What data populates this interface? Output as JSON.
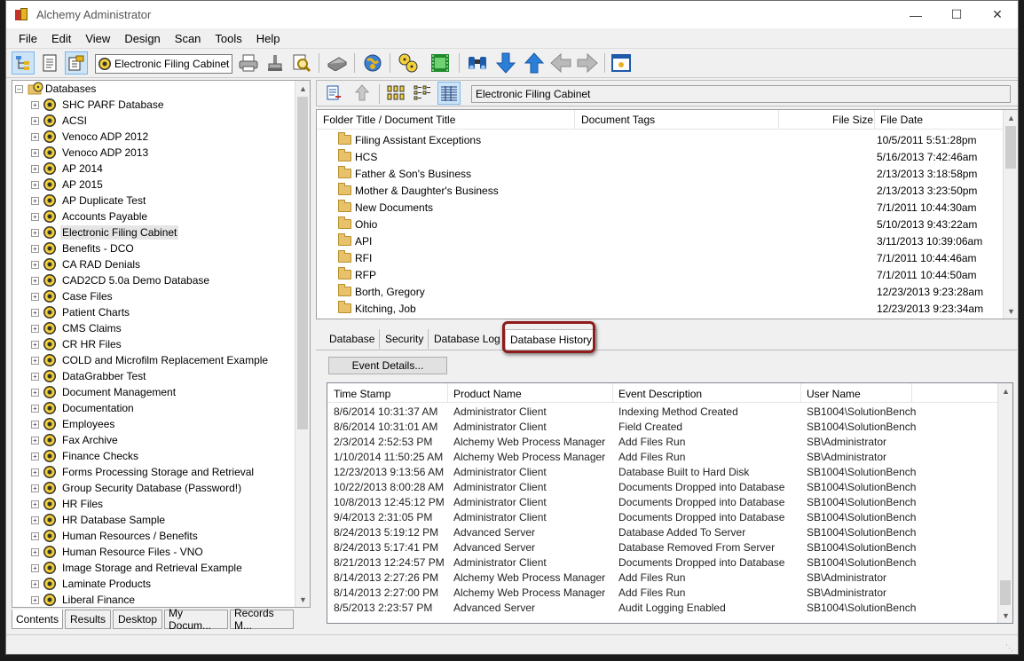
{
  "window": {
    "title": "Alchemy Administrator",
    "controls": {
      "minimize": "—",
      "maximize": "☐",
      "close": "✕"
    }
  },
  "menu": [
    "File",
    "Edit",
    "View",
    "Design",
    "Scan",
    "Tools",
    "Help"
  ],
  "toolbar": {
    "database_combo_value": "Electronic Filing Cabinet"
  },
  "tree": {
    "root_label": "Databases",
    "items": [
      "SHC PARF Database",
      "ACSI",
      "Venoco ADP 2012",
      "Venoco ADP 2013",
      "AP 2014",
      "AP 2015",
      "AP Duplicate Test",
      "Accounts Payable",
      "Electronic Filing Cabinet",
      "Benefits - DCO",
      "CA RAD Denials",
      "CAD2CD 5.0a Demo Database",
      "Case Files",
      "Patient Charts",
      "CMS Claims",
      "CR HR Files",
      "COLD and Microfilm Replacement Example",
      "DataGrabber Test",
      "Document Management",
      "Documentation",
      "Employees",
      "Fax Archive",
      "Finance Checks",
      "Forms Processing Storage and Retrieval",
      "Group Security Database (Password!)",
      "HR Files",
      "HR Database Sample",
      "Human Resources / Benefits",
      "Human Resource Files - VNO",
      "Image Storage and Retrieval Example",
      "Laminate Products",
      "Liberal Finance"
    ],
    "selected": "Electronic Filing Cabinet"
  },
  "left_tabs": [
    "Contents",
    "Results",
    "Desktop",
    "My Docum...",
    "Records M..."
  ],
  "right_toolbar": {
    "path": "Electronic Filing Cabinet"
  },
  "file_list": {
    "columns": [
      "Folder Title / Document Title",
      "Document Tags",
      "File Size",
      "File Date"
    ],
    "rows": [
      {
        "title": "Filing Assistant Exceptions",
        "date": "10/5/2011 5:51:28pm"
      },
      {
        "title": "HCS",
        "date": "5/16/2013 7:42:46am"
      },
      {
        "title": "Father & Son's Business",
        "date": "2/13/2013 3:18:58pm"
      },
      {
        "title": "Mother & Daughter's Business",
        "date": "2/13/2013 3:23:50pm"
      },
      {
        "title": "New Documents",
        "date": "7/1/2011 10:44:30am"
      },
      {
        "title": "Ohio",
        "date": "5/10/2013 9:43:22am"
      },
      {
        "title": "API",
        "date": "3/11/2013 10:39:06am"
      },
      {
        "title": "RFI",
        "date": "7/1/2011 10:44:46am"
      },
      {
        "title": "RFP",
        "date": "7/1/2011 10:44:50am"
      },
      {
        "title": "Borth, Gregory",
        "date": "12/23/2013 9:23:28am"
      },
      {
        "title": "Kitching, Job",
        "date": "12/23/2013 9:23:34am"
      }
    ]
  },
  "detail_tabs": [
    "Database",
    "Security",
    "Database Log",
    "Database History"
  ],
  "event_details_button": "Event Details...",
  "history": {
    "columns": [
      "Time Stamp",
      "Product Name",
      "Event Description",
      "User Name"
    ],
    "rows": [
      [
        "8/6/2014 10:31:37 AM",
        "Administrator Client",
        "Indexing Method Created",
        "SB1004\\SolutionBench"
      ],
      [
        "8/6/2014 10:31:01 AM",
        "Administrator Client",
        "Field Created",
        "SB1004\\SolutionBench"
      ],
      [
        "2/3/2014 2:52:53 PM",
        "Alchemy Web Process Manager",
        "Add Files Run",
        "SB\\Administrator"
      ],
      [
        "1/10/2014 11:50:25 AM",
        "Alchemy Web Process Manager",
        "Add Files Run",
        "SB\\Administrator"
      ],
      [
        "12/23/2013 9:13:56 AM",
        "Administrator Client",
        "Database Built to Hard Disk",
        "SB1004\\SolutionBench"
      ],
      [
        "10/22/2013 8:00:28 AM",
        "Administrator Client",
        "Documents Dropped into Database",
        "SB1004\\SolutionBench"
      ],
      [
        "10/8/2013 12:45:12 PM",
        "Administrator Client",
        "Documents Dropped into Database",
        "SB1004\\SolutionBench"
      ],
      [
        "9/4/2013 2:31:05 PM",
        "Administrator Client",
        "Documents Dropped into Database",
        "SB1004\\SolutionBench"
      ],
      [
        "8/24/2013 5:19:12 PM",
        "Advanced Server",
        "Database Added To Server",
        "SB1004\\SolutionBench"
      ],
      [
        "8/24/2013 5:17:41 PM",
        "Advanced Server",
        "Database Removed From Server",
        "SB1004\\SolutionBench"
      ],
      [
        "8/21/2013 12:24:57 PM",
        "Administrator Client",
        "Documents Dropped into Database",
        "SB1004\\SolutionBench"
      ],
      [
        "8/14/2013 2:27:26 PM",
        "Alchemy Web Process Manager",
        "Add Files Run",
        "SB\\Administrator"
      ],
      [
        "8/14/2013 2:27:00 PM",
        "Alchemy Web Process Manager",
        "Add Files Run",
        "SB\\Administrator"
      ],
      [
        "8/5/2013 2:23:57 PM",
        "Advanced Server",
        "Audit Logging Enabled",
        "SB1004\\SolutionBench"
      ]
    ]
  },
  "icons": {
    "tree": "tree-view-icon",
    "document": "document-icon",
    "cabinet": "cabinet-icon",
    "printer": "printer-icon",
    "stamp": "stamp-icon",
    "search-doc": "search-document-icon",
    "scanner": "scanner-icon",
    "globe": "globe-icon",
    "discs": "discs-icon",
    "film": "film-icon",
    "binoculars": "binoculars-icon",
    "arrow-down": "arrow-down-icon",
    "arrow-up": "arrow-up-icon",
    "arrow-left": "arrow-left-icon",
    "arrow-right": "arrow-right-icon",
    "window": "window-icon"
  },
  "colors": {
    "highlight_border": "#8e1c1c",
    "arrow_blue": "#2a7fd8",
    "arrow_gray": "#b9b9b9"
  }
}
